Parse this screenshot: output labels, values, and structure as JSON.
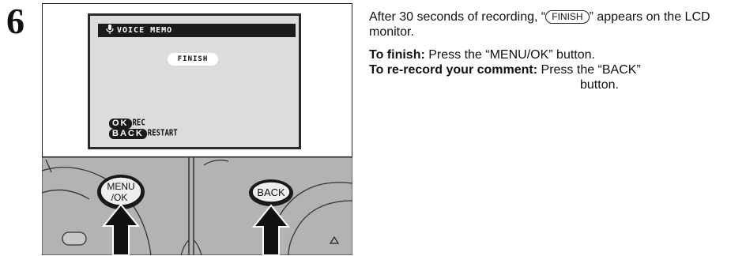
{
  "step": {
    "number": "6"
  },
  "lcd": {
    "title": "VOICE MEMO",
    "status_pill": "FINISH",
    "legend": [
      {
        "key": "OK",
        "label": "REC"
      },
      {
        "key": "BACK",
        "label": "RESTART"
      }
    ]
  },
  "camera": {
    "menu_button": {
      "line1": "MENU",
      "line2": "/OK"
    },
    "back_button": "BACK"
  },
  "instructions": {
    "intro_prefix": "After 30 seconds of recording, “",
    "intro_finish": "FINISH",
    "intro_suffix": "” appears on the LCD monitor.",
    "finish_label": "To finish:",
    "finish_text": " Press the “MENU/OK” button.",
    "rerecord_label": "To re-record your comment:",
    "rerecord_text": " Press the “BACK”",
    "rerecord_text_cont": "button."
  }
}
